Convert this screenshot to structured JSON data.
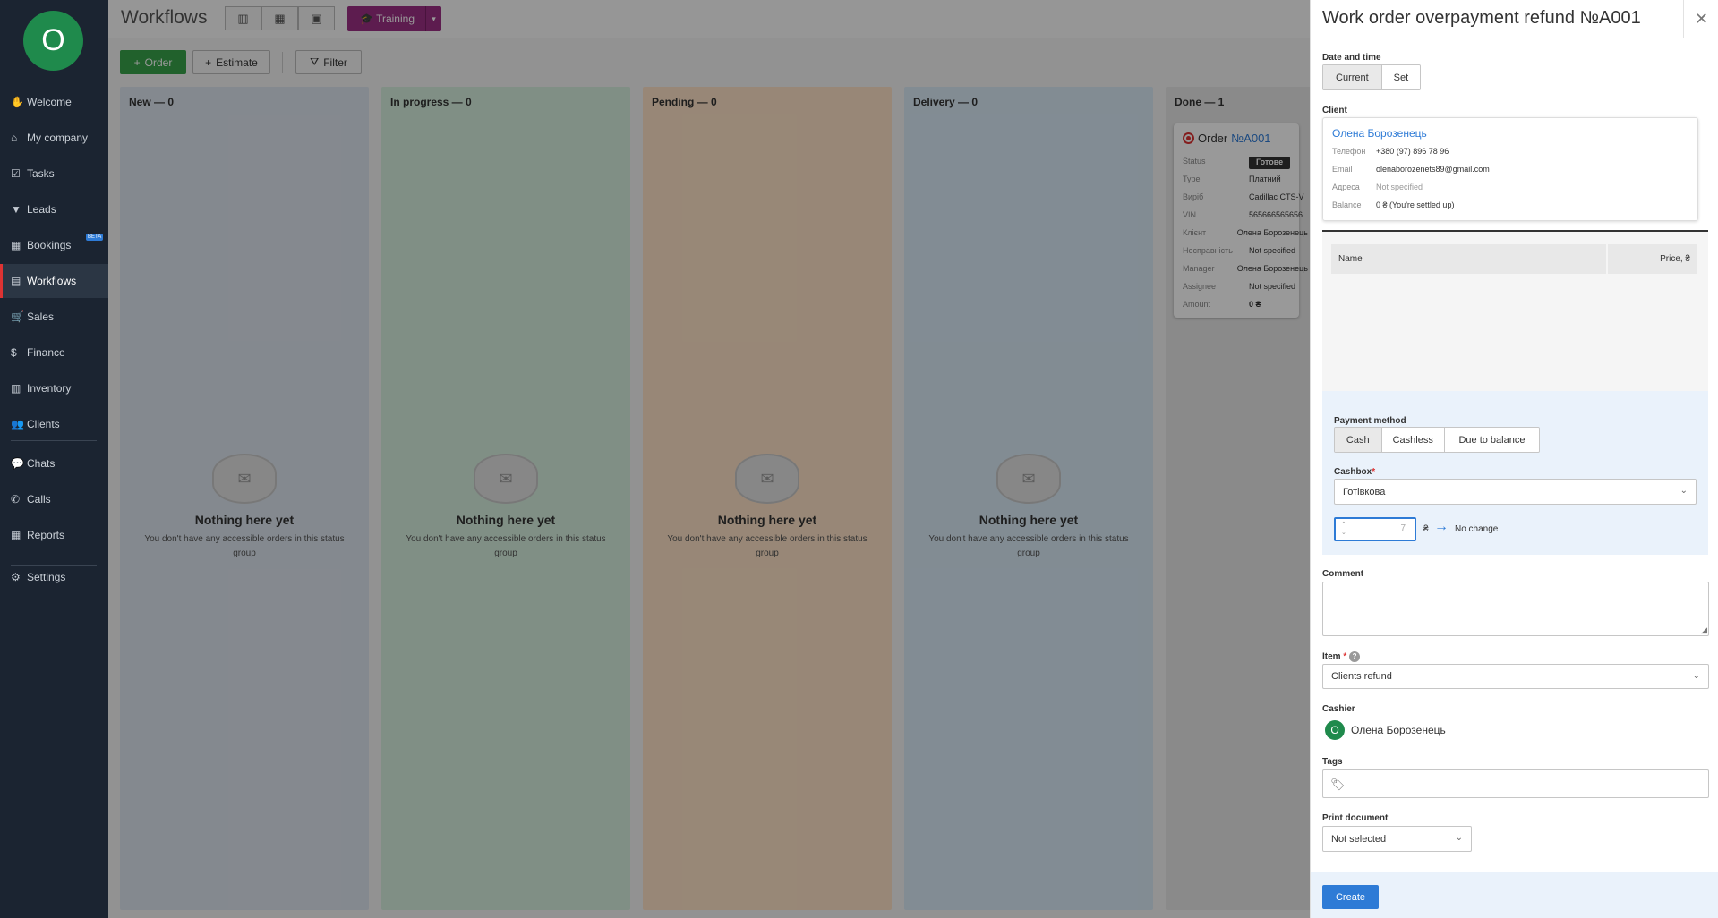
{
  "sidebar": {
    "avatar_letter": "O",
    "items": [
      {
        "label": "Welcome",
        "icon": "✋",
        "icon_name": "wave-hand-icon"
      },
      {
        "label": "My company",
        "icon": "⌂",
        "icon_name": "home-icon"
      },
      {
        "label": "Tasks",
        "icon": "☑",
        "icon_name": "tasks-icon"
      },
      {
        "label": "Leads",
        "icon": "▼",
        "icon_name": "funnel-icon"
      },
      {
        "label": "Bookings",
        "icon": "▦",
        "icon_name": "calendar-icon",
        "badge": "BETA"
      },
      {
        "label": "Workflows",
        "icon": "▤",
        "icon_name": "workflows-icon"
      },
      {
        "label": "Sales",
        "icon": "🛒",
        "icon_name": "cart-icon"
      },
      {
        "label": "Finance",
        "icon": "$",
        "icon_name": "finance-icon"
      },
      {
        "label": "Inventory",
        "icon": "▥",
        "icon_name": "inventory-icon"
      },
      {
        "label": "Clients",
        "icon": "👥",
        "icon_name": "clients-icon"
      },
      {
        "label": "Chats",
        "icon": "💬",
        "icon_name": "chat-icon"
      },
      {
        "label": "Calls",
        "icon": "✆",
        "icon_name": "phone-icon"
      },
      {
        "label": "Reports",
        "icon": "▦",
        "icon_name": "reports-icon"
      },
      {
        "label": "Settings",
        "icon": "⚙",
        "icon_name": "gear-icon"
      }
    ]
  },
  "header": {
    "title": "Workflows",
    "training_label": "Training"
  },
  "toolbar": {
    "order_label": "Order",
    "estimate_label": "Estimate",
    "filter_label": "Filter"
  },
  "columns": [
    {
      "title": "New — 0",
      "color": "#dde5ee"
    },
    {
      "title": "In progress — 0",
      "color": "#d6eede"
    },
    {
      "title": "Pending — 0",
      "color": "#fde2c6"
    },
    {
      "title": "Delivery — 0",
      "color": "#d9eaf6"
    },
    {
      "title": "Done — 1",
      "color": "#e6e6e6"
    }
  ],
  "empty_state": {
    "title": "Nothing here yet",
    "description": "You don't have any accessible orders in this status group"
  },
  "card": {
    "prefix": "Order",
    "number": "№A001",
    "rows": [
      {
        "key": "Status",
        "value": "Готове"
      },
      {
        "key": "Type",
        "value": "Платний"
      },
      {
        "key": "Виріб",
        "value": "Cadillac CTS-V"
      },
      {
        "key": "VIN",
        "value": "565666565656"
      },
      {
        "key": "Клієнт",
        "value": "Олена Борозенець"
      },
      {
        "key": "Несправність",
        "value": "Not specified"
      },
      {
        "key": "Manager",
        "value": "Олена Борозенець"
      },
      {
        "key": "Assignee",
        "value": "Not specified"
      },
      {
        "key": "Amount",
        "value": "0 ₴"
      }
    ]
  },
  "panel": {
    "title": "Work order overpayment refund №A001",
    "date_label": "Date and time",
    "date_options": [
      "Current",
      "Set"
    ],
    "client_label": "Client",
    "client": {
      "name": "Олена Борозенець",
      "rows": [
        {
          "key": "Телефон",
          "value": "+380 (97) 896 78 96"
        },
        {
          "key": "Email",
          "value": "olenaborozenets89@gmail.com"
        },
        {
          "key": "Адреса",
          "value": "Not specified"
        },
        {
          "key": "Balance",
          "value": "0 ₴ (You're settled up)"
        }
      ]
    },
    "items_columns": {
      "name": "Name",
      "price": "Price, ₴"
    },
    "payment_method_label": "Payment method",
    "payment_methods": [
      "Cash",
      "Cashless",
      "Due to balance"
    ],
    "cashbox_label": "Cashbox",
    "cashbox_value": "Готівкова",
    "amount_value": "7",
    "currency": "₴",
    "balance_change": "No change",
    "comment_label": "Comment",
    "item_label": "Item",
    "item_value": "Clients refund",
    "cashier_label": "Cashier",
    "cashier_initial": "O",
    "cashier_name": "Олена Борозенець",
    "tags_label": "Tags",
    "print_label": "Print document",
    "print_value": "Not selected",
    "create_label": "Create"
  }
}
